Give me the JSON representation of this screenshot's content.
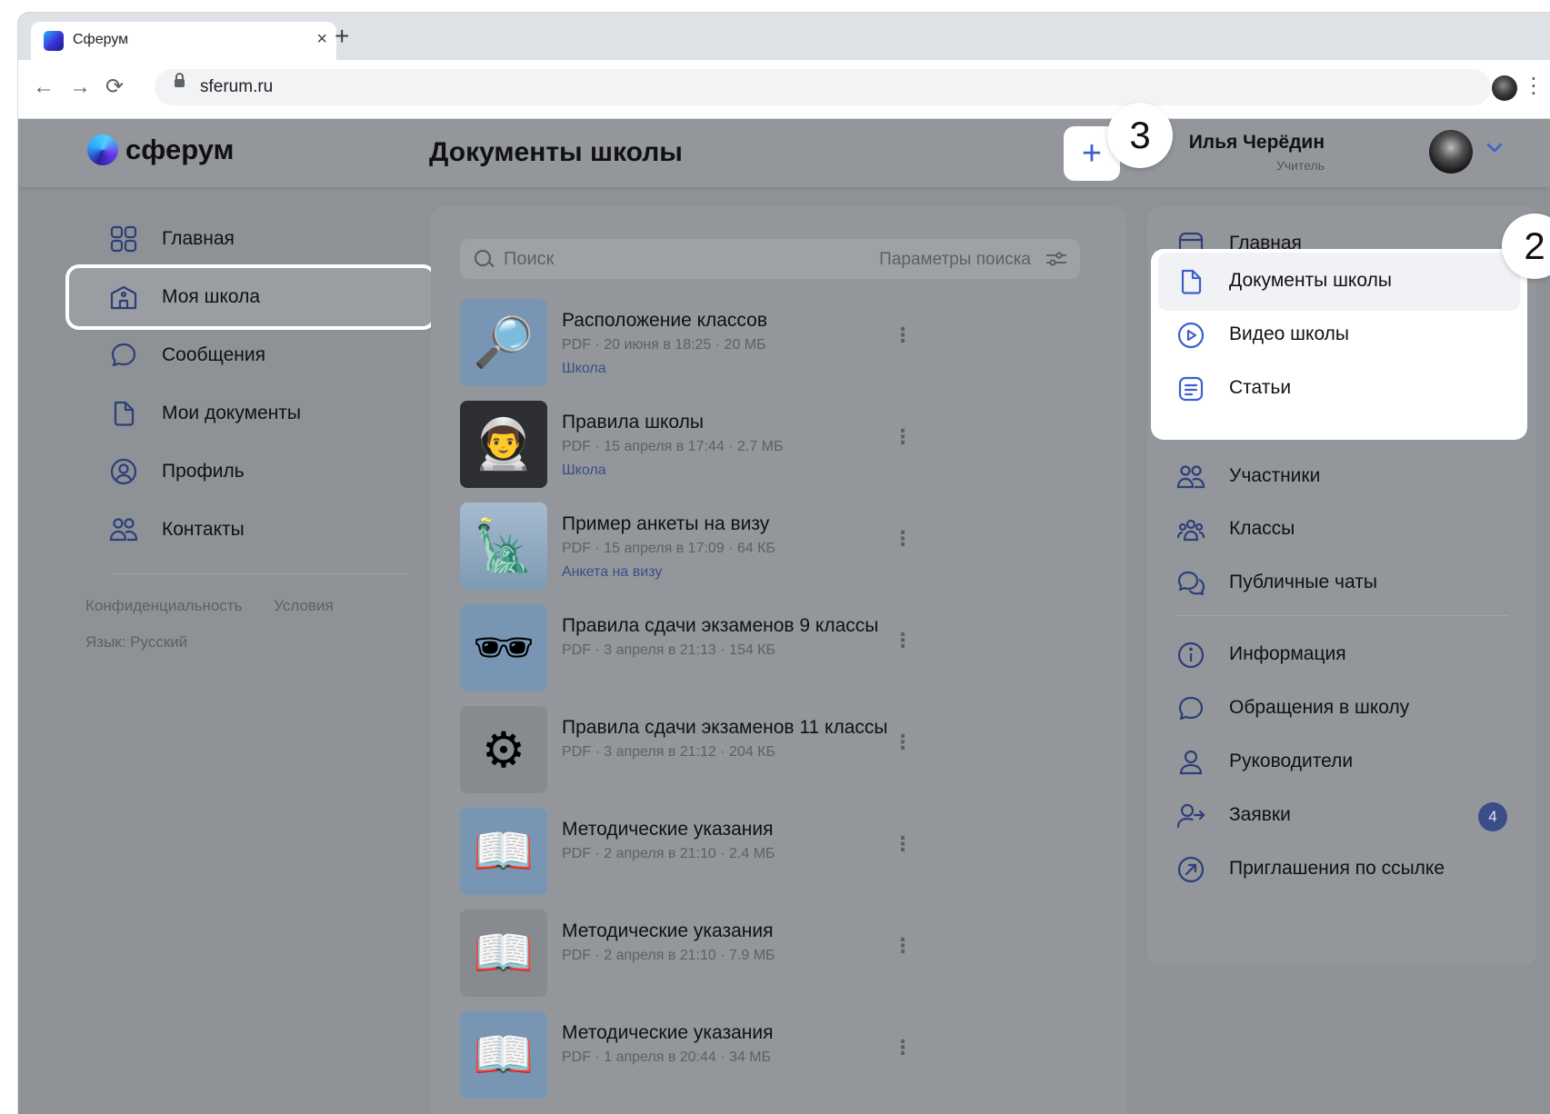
{
  "browser": {
    "tab_title": "Сферум",
    "tab_close": "×",
    "new_tab": "+",
    "url": "sferum.ru",
    "back": "←",
    "forward": "→",
    "reload": "⟳",
    "menu": "⋮"
  },
  "header": {
    "logo_text": "сферум",
    "page_title": "Документы школы",
    "add_label": "+",
    "user_name": "Илья Черёдин",
    "user_role": "Учитель",
    "chevron": "⌄"
  },
  "callouts": {
    "add_button_number": "3",
    "menu_number": "2"
  },
  "left_nav": {
    "items": [
      {
        "label": "Главная",
        "icon": "grid-icon",
        "active": false
      },
      {
        "label": "Моя школа",
        "icon": "school-building-icon",
        "active": true
      },
      {
        "label": "Сообщения",
        "icon": "chat-bubble-icon",
        "active": false
      },
      {
        "label": "Мои документы",
        "icon": "document-icon",
        "active": false
      },
      {
        "label": "Профиль",
        "icon": "user-circle-icon",
        "active": false
      },
      {
        "label": "Контакты",
        "icon": "people-icon",
        "active": false
      }
    ],
    "footer": {
      "privacy": "Конфиденциальность",
      "terms": "Условия",
      "language": "Язык: Русский"
    }
  },
  "search": {
    "placeholder": "Поиск",
    "params_label": "Параметры поиска"
  },
  "documents": [
    {
      "title": "Расположение классов",
      "meta": "PDF · 20 июня в 18:25 · 20 МБ",
      "tag": "Школа",
      "thumb": "magnifier",
      "glyph": "🔎"
    },
    {
      "title": "Правила школы",
      "meta": "PDF · 15 апреля в 17:44 · 2.7 МБ",
      "tag": "Школа",
      "thumb": "astronaut",
      "glyph": "👨‍🚀"
    },
    {
      "title": "Пример анкеты на визу",
      "meta": "PDF · 15 апреля в 17:09 · 64 КБ",
      "tag": "Анкета на визу",
      "thumb": "statue-of-liberty",
      "glyph": "🗽"
    },
    {
      "title": "Правила сдачи экзаменов 9 классы",
      "meta": "PDF · 3 апреля в 21:13 · 154 КБ",
      "tag": "",
      "thumb": "sunglasses",
      "glyph": "🕶"
    },
    {
      "title": "Правила сдачи экзаменов 11 классы",
      "meta": "PDF · 3 апреля в 21:12 · 204 КБ",
      "tag": "",
      "thumb": "gear",
      "glyph": "⚙"
    },
    {
      "title": "Методические указания",
      "meta": "PDF · 2 апреля в 21:10 · 2.4 МБ",
      "tag": "",
      "thumb": "open-book",
      "glyph": "📖"
    },
    {
      "title": "Методические указания",
      "meta": "PDF · 2 апреля в 21:10 · 7.9 МБ",
      "tag": "",
      "thumb": "open-book",
      "glyph": "📖"
    },
    {
      "title": "Методические указания",
      "meta": "PDF · 1 апреля в 20:44 · 34 МБ",
      "tag": "",
      "thumb": "open-book",
      "glyph": "📖"
    }
  ],
  "right_nav": {
    "home": "Главная",
    "school_docs": "Документы школы",
    "school_video": "Видео школы",
    "articles": "Статьи",
    "members": "Участники",
    "classes": "Классы",
    "public_chats": "Публичные чаты",
    "info": "Информация",
    "appeals": "Обращения в школу",
    "leaders": "Руководители",
    "requests": "Заявки",
    "requests_badge": "4",
    "invites": "Приглашения по ссылке"
  },
  "colors": {
    "accent": "#3f5fcc",
    "overlay_bg": "#8e9196",
    "badge": "#3a4d89"
  }
}
